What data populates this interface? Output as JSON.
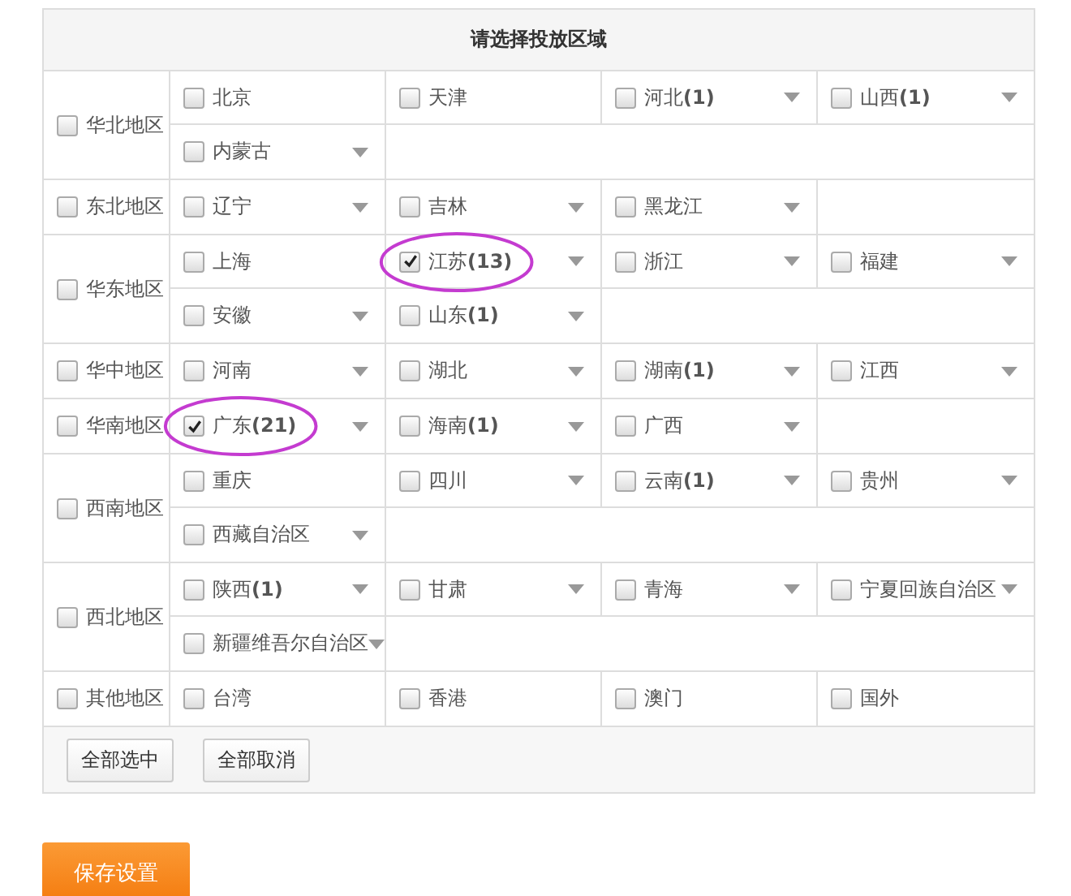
{
  "title": "请选择投放区域",
  "regions": [
    {
      "name": "华北地区",
      "checked": false,
      "lines": [
        [
          {
            "name": "北京",
            "checked": false,
            "menu": false,
            "circled": false
          },
          {
            "name": "天津",
            "checked": false,
            "menu": false,
            "circled": false
          },
          {
            "name": "河北",
            "count": "(1)",
            "checked": false,
            "menu": true,
            "circled": false
          },
          {
            "name": "山西",
            "count": "(1)",
            "checked": false,
            "menu": true,
            "circled": false
          }
        ],
        [
          {
            "name": "内蒙古",
            "checked": false,
            "menu": true,
            "circled": false
          }
        ]
      ]
    },
    {
      "name": "东北地区",
      "checked": false,
      "lines": [
        [
          {
            "name": "辽宁",
            "checked": false,
            "menu": true,
            "circled": false
          },
          {
            "name": "吉林",
            "checked": false,
            "menu": true,
            "circled": false
          },
          {
            "name": "黑龙江",
            "checked": false,
            "menu": true,
            "circled": false
          }
        ]
      ]
    },
    {
      "name": "华东地区",
      "checked": false,
      "lines": [
        [
          {
            "name": "上海",
            "checked": false,
            "menu": false,
            "circled": false
          },
          {
            "name": "江苏",
            "count": "(13)",
            "checked": true,
            "menu": true,
            "circled": true
          },
          {
            "name": "浙江",
            "checked": false,
            "menu": true,
            "circled": false
          },
          {
            "name": "福建",
            "checked": false,
            "menu": true,
            "circled": false
          }
        ],
        [
          {
            "name": "安徽",
            "checked": false,
            "menu": true,
            "circled": false
          },
          {
            "name": "山东",
            "count": "(1)",
            "checked": false,
            "menu": true,
            "circled": false
          }
        ]
      ]
    },
    {
      "name": "华中地区",
      "checked": false,
      "lines": [
        [
          {
            "name": "河南",
            "checked": false,
            "menu": true,
            "circled": false
          },
          {
            "name": "湖北",
            "checked": false,
            "menu": true,
            "circled": false
          },
          {
            "name": "湖南",
            "count": "(1)",
            "checked": false,
            "menu": true,
            "circled": false
          },
          {
            "name": "江西",
            "checked": false,
            "menu": true,
            "circled": false
          }
        ]
      ]
    },
    {
      "name": "华南地区",
      "checked": false,
      "lines": [
        [
          {
            "name": "广东",
            "count": "(21)",
            "checked": true,
            "menu": true,
            "circled": true
          },
          {
            "name": "海南",
            "count": "(1)",
            "checked": false,
            "menu": true,
            "circled": false
          },
          {
            "name": "广西",
            "checked": false,
            "menu": true,
            "circled": false
          }
        ]
      ]
    },
    {
      "name": "西南地区",
      "checked": false,
      "lines": [
        [
          {
            "name": "重庆",
            "checked": false,
            "menu": false,
            "circled": false
          },
          {
            "name": "四川",
            "checked": false,
            "menu": true,
            "circled": false
          },
          {
            "name": "云南",
            "count": "(1)",
            "checked": false,
            "menu": true,
            "circled": false
          },
          {
            "name": "贵州",
            "checked": false,
            "menu": true,
            "circled": false
          }
        ],
        [
          {
            "name": "西藏自治区",
            "checked": false,
            "menu": true,
            "circled": false
          }
        ]
      ]
    },
    {
      "name": "西北地区",
      "checked": false,
      "lines": [
        [
          {
            "name": "陕西",
            "count": "(1)",
            "checked": false,
            "menu": true,
            "circled": false
          },
          {
            "name": "甘肃",
            "checked": false,
            "menu": true,
            "circled": false
          },
          {
            "name": "青海",
            "checked": false,
            "menu": true,
            "circled": false
          },
          {
            "name": "宁夏回族自治区",
            "checked": false,
            "menu": true,
            "circled": false
          }
        ],
        [
          {
            "name": "新疆维吾尔自治区",
            "checked": false,
            "menu": true,
            "circled": false
          }
        ]
      ]
    },
    {
      "name": "其他地区",
      "checked": false,
      "lines": [
        [
          {
            "name": "台湾",
            "checked": false,
            "menu": false,
            "circled": false
          },
          {
            "name": "香港",
            "checked": false,
            "menu": false,
            "circled": false
          },
          {
            "name": "澳门",
            "checked": false,
            "menu": false,
            "circled": false
          },
          {
            "name": "国外",
            "checked": false,
            "menu": false,
            "circled": false
          }
        ]
      ]
    }
  ],
  "buttons": [
    "全部选中",
    "全部取消"
  ],
  "save_button": "保存设置"
}
